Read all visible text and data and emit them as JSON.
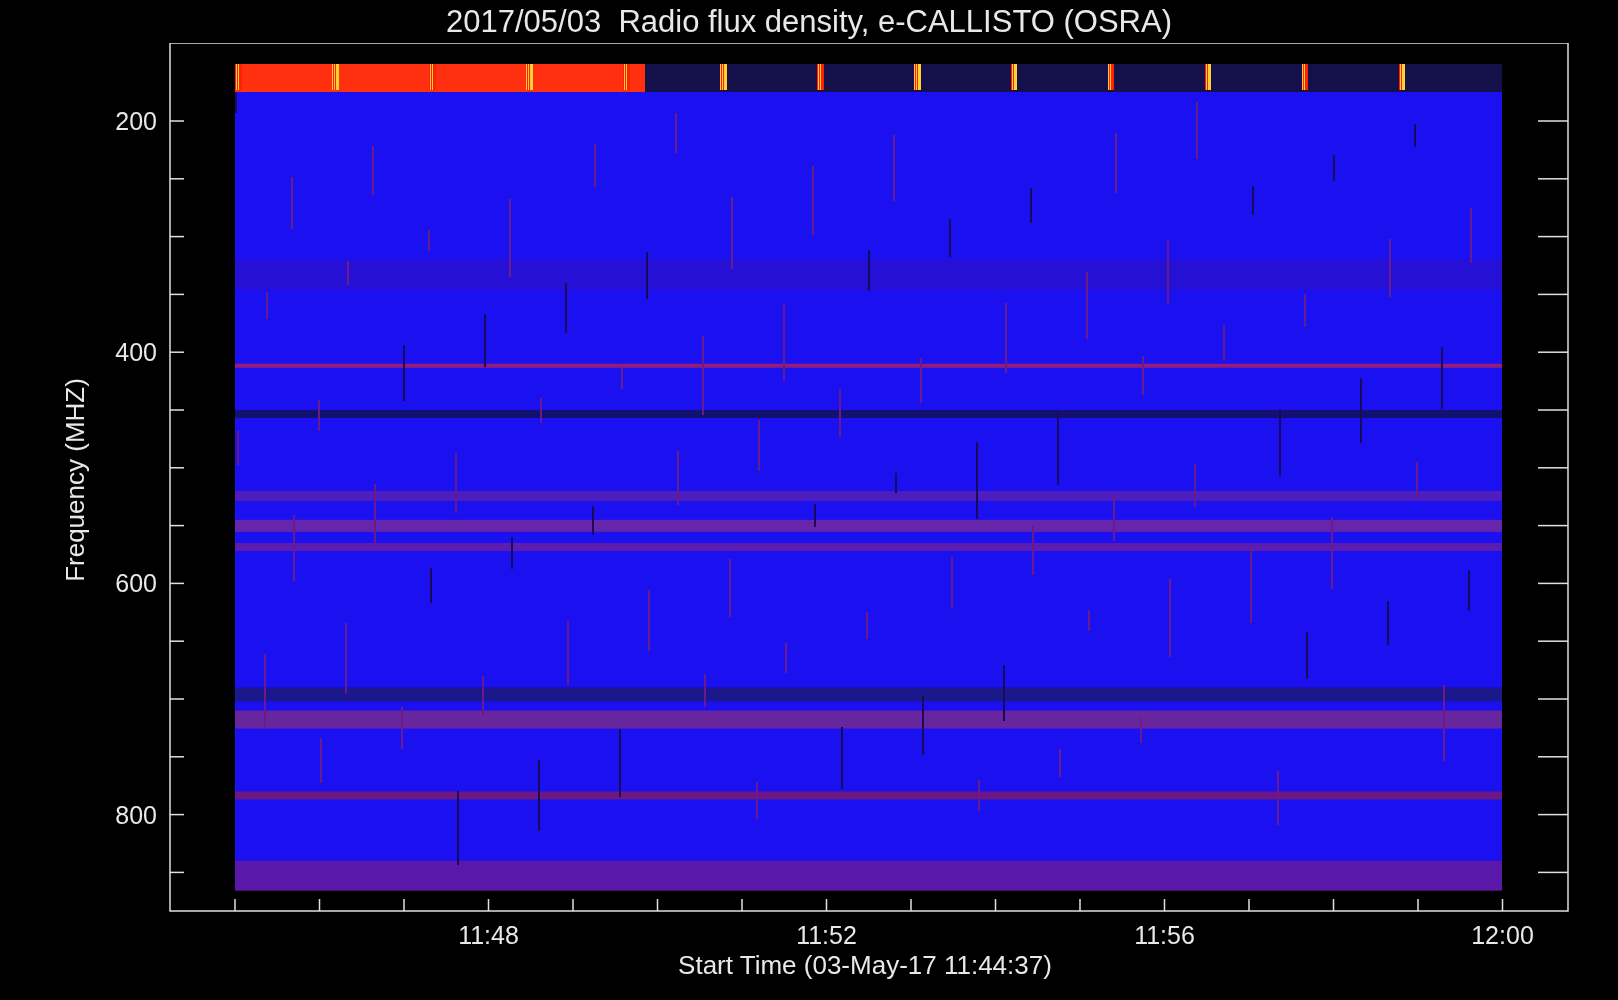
{
  "title": "2017/05/03  Radio flux density, e-CALLISTO (OSRA)",
  "y_axis": {
    "label": "Frequency (MHZ)",
    "ticks": [
      "200",
      "400",
      "600",
      "800"
    ]
  },
  "x_axis": {
    "label": "Start Time (03-May-17 11:44:37)",
    "ticks": [
      "11:48",
      "11:52",
      "11:56",
      "12:00"
    ]
  }
}
